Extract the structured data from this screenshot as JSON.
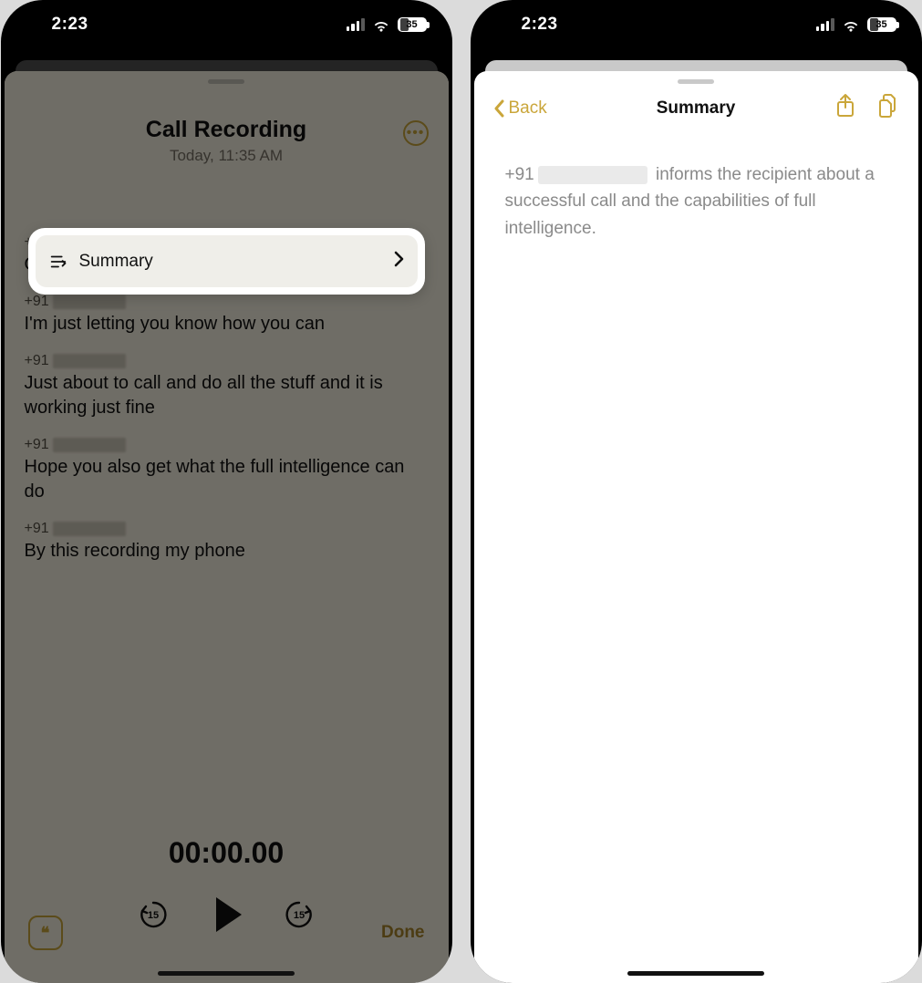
{
  "status": {
    "time": "2:23",
    "battery_pct": "35",
    "battery_fill_pct": 35
  },
  "left": {
    "title": "Call Recording",
    "subtitle": "Today, 11:35 AM",
    "summary_label": "Summary",
    "caller_prefix": "+91",
    "transcript": [
      {
        "text": "Oh"
      },
      {
        "text": "I'm just letting you know how you can"
      },
      {
        "text": "Just about to call and do all the stuff and it is working just fine"
      },
      {
        "text": "Hope you also get what the full intelligence can do"
      },
      {
        "text": "By this recording my phone"
      }
    ],
    "timer": "00:00.00",
    "skip_back_seconds": "15",
    "skip_fwd_seconds": "15",
    "done_label": "Done"
  },
  "right": {
    "back_label": "Back",
    "title": "Summary",
    "body_prefix": "+91",
    "body_rest": " informs the recipient about a successful call and the capabilities of full intelligence."
  }
}
